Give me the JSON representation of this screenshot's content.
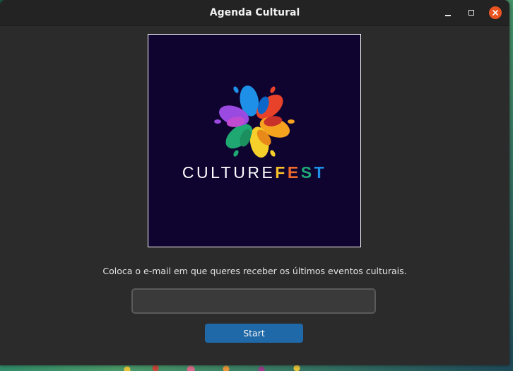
{
  "window": {
    "title": "Agenda Cultural",
    "controls": [
      "minimize-icon",
      "maximize-icon",
      "close-icon"
    ]
  },
  "logo": {
    "text_part1": "CULTURE",
    "text_part2_letters": [
      "F",
      "E",
      "S",
      "T"
    ],
    "colors": {
      "background": "#0f0330",
      "F": "#f5c02a",
      "E": "#f06a2a",
      "S": "#1faa78",
      "T": "#1e90e8"
    }
  },
  "form": {
    "prompt": "Coloca o e-mail em que queres receber os últimos eventos culturais.",
    "email_value": "",
    "start_label": "Start"
  },
  "colors": {
    "accent": "#2069a8",
    "close": "#e95420"
  }
}
